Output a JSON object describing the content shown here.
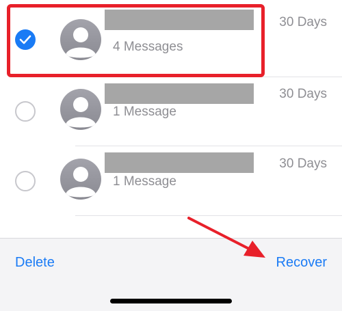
{
  "conversations": [
    {
      "selected": true,
      "count_label": "4 Messages",
      "days_label": "30 Days",
      "name_redacted": true
    },
    {
      "selected": false,
      "count_label": "1 Message",
      "days_label": "30 Days",
      "name_redacted": true
    },
    {
      "selected": false,
      "count_label": "1 Message",
      "days_label": "30 Days",
      "name_redacted": true
    }
  ],
  "toolbar": {
    "delete_label": "Delete",
    "recover_label": "Recover"
  },
  "colors": {
    "accent": "#1a7bf5",
    "annotation": "#e8202a",
    "secondary_text": "#8e8e93",
    "redaction": "#a6a6a6"
  },
  "icons": {
    "selected": "checkmark-circle-icon",
    "unselected": "empty-circle-icon",
    "avatar": "person-placeholder-icon"
  }
}
